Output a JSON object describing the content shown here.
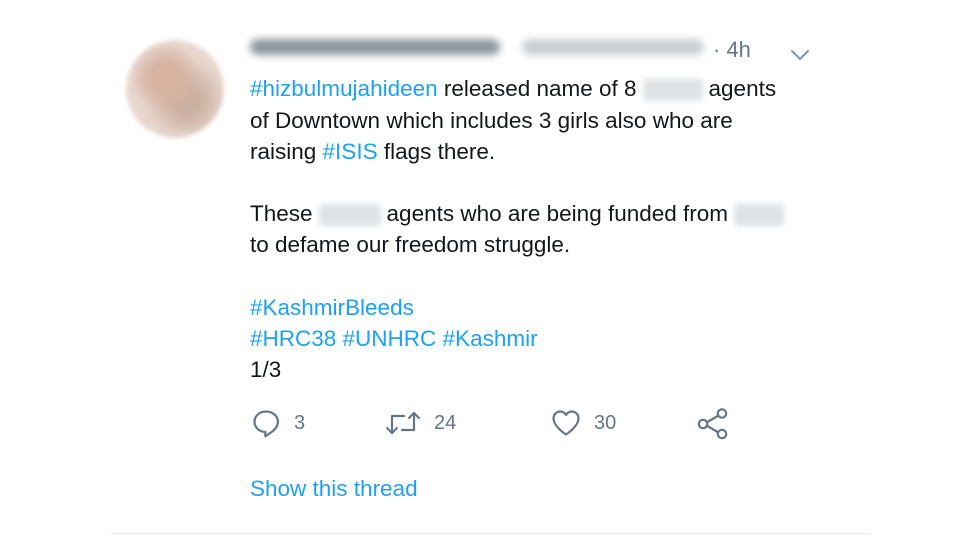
{
  "tweet": {
    "timestamp": "· 4h",
    "line1": {
      "hashtag": "#hizbulmujahideen",
      "text_a": "released name of 8",
      "text_b": "agents"
    },
    "line2": "of Downtown which includes 3 girls also who are",
    "line3": {
      "text_a": "raising",
      "hashtag": "#ISIS",
      "text_b": "flags there."
    },
    "line4": {
      "text_a": "These",
      "text_b": "agents who are being funded from"
    },
    "line5": "to defame our freedom struggle.",
    "hashtags_1": "#KashmirBleeds",
    "hashtags_2": "#HRC38 #UNHRC #Kashmir",
    "thread_position": "1/3",
    "actions": {
      "reply_count": "3",
      "retweet_count": "24",
      "like_count": "30"
    },
    "show_thread_label": "Show this thread"
  },
  "icons": {
    "reply": "reply-icon",
    "retweet": "retweet-icon",
    "like": "heart-icon",
    "share": "share-icon",
    "menu": "chevron-down-icon"
  },
  "colors": {
    "link": "#1da1f2",
    "text": "#14171a",
    "secondary": "#657786",
    "divider": "#e6ecf0"
  }
}
